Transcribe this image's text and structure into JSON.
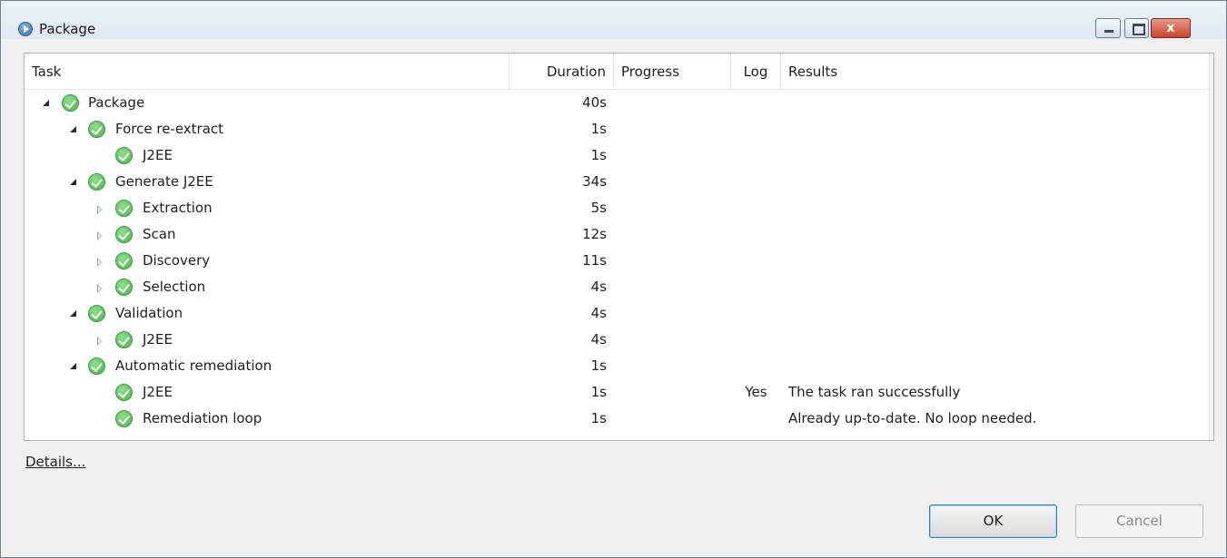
{
  "window": {
    "title": "Package",
    "close_glyph": "x"
  },
  "columns": {
    "task": "Task",
    "duration": "Duration",
    "progress": "Progress",
    "log": "Log",
    "results": "Results"
  },
  "rows": [
    {
      "label": "Package",
      "duration": "40s",
      "log": "",
      "results": "",
      "toggle": "expanded",
      "level": 0
    },
    {
      "label": "Force re-extract",
      "duration": "1s",
      "log": "",
      "results": "",
      "toggle": "expanded",
      "level": 1
    },
    {
      "label": "J2EE",
      "duration": "1s",
      "log": "",
      "results": "",
      "toggle": "none",
      "level": 2
    },
    {
      "label": "Generate J2EE",
      "duration": "34s",
      "log": "",
      "results": "",
      "toggle": "expanded",
      "level": 1
    },
    {
      "label": "Extraction",
      "duration": "5s",
      "log": "",
      "results": "",
      "toggle": "collapsed",
      "level": 2
    },
    {
      "label": "Scan",
      "duration": "12s",
      "log": "",
      "results": "",
      "toggle": "collapsed",
      "level": 2
    },
    {
      "label": "Discovery",
      "duration": "11s",
      "log": "",
      "results": "",
      "toggle": "collapsed",
      "level": 2
    },
    {
      "label": "Selection",
      "duration": "4s",
      "log": "",
      "results": "",
      "toggle": "collapsed",
      "level": 2
    },
    {
      "label": "Validation",
      "duration": "4s",
      "log": "",
      "results": "",
      "toggle": "expanded",
      "level": 1
    },
    {
      "label": "J2EE",
      "duration": "4s",
      "log": "",
      "results": "",
      "toggle": "collapsed",
      "level": 2
    },
    {
      "label": "Automatic remediation",
      "duration": "1s",
      "log": "",
      "results": "",
      "toggle": "expanded",
      "level": 1
    },
    {
      "label": "J2EE",
      "duration": "1s",
      "log": "Yes",
      "results": "The task ran successfully",
      "toggle": "none",
      "level": 2
    },
    {
      "label": "Remediation loop",
      "duration": "1s",
      "log": "",
      "results": "Already up-to-date. No loop needed.",
      "toggle": "none",
      "level": 2
    }
  ],
  "footer": {
    "details_link": "Details...",
    "ok_label": "OK",
    "cancel_label": "Cancel"
  },
  "icons": {
    "status": "success-check-icon",
    "app": "play-circle-icon"
  },
  "colors": {
    "success": "#4bb14b",
    "close_button": "#c8432e"
  }
}
